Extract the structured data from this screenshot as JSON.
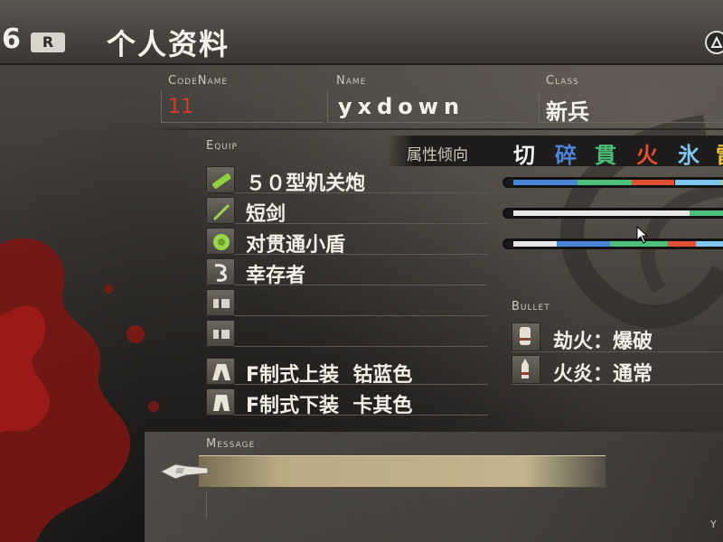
{
  "header": {
    "page_number": "6",
    "r_button": "R",
    "title": "个人资料",
    "triangle_icon": "triangle-button-icon"
  },
  "profile": {
    "codename_label": "CodeName",
    "codename_value": "11",
    "name_label": "Name",
    "name_value": "yxdown",
    "class_label": "Class",
    "class_value": "新兵"
  },
  "equip": {
    "label": "Equip",
    "items": [
      {
        "icon": "machine-gun-icon",
        "label": "５０型机关炮"
      },
      {
        "icon": "sword-icon",
        "label": "短剑"
      },
      {
        "icon": "shield-icon",
        "label": "对贯通小盾"
      },
      {
        "icon": "survivor-skill-icon",
        "label": "幸存者"
      },
      {
        "icon": "empty-slot-icon",
        "label": ""
      },
      {
        "icon": "empty-slot-icon",
        "label": ""
      },
      {
        "icon": "armor-top-icon",
        "label": "F制式上装  钴蓝色"
      },
      {
        "icon": "armor-bottom-icon",
        "label": "F制式下装  卡其色"
      }
    ]
  },
  "attributes": {
    "label": "属性倾向",
    "types": [
      {
        "label": "切",
        "color": "#f2f2f2"
      },
      {
        "label": "碎",
        "color": "#4a86d8"
      },
      {
        "label": "貫",
        "color": "#4cc07a"
      },
      {
        "label": "火",
        "color": "#e0502e"
      },
      {
        "label": "氷",
        "color": "#7ec6ee"
      },
      {
        "label": "雷",
        "color": "#e8c23a"
      }
    ],
    "gauges": [
      [
        {
          "color": "#4a86d8",
          "from": 0.0,
          "to": 0.3
        },
        {
          "color": "#4cc07a",
          "from": 0.3,
          "to": 0.55
        },
        {
          "color": "#e0502e",
          "from": 0.55,
          "to": 0.75
        },
        {
          "color": "#7ec6ee",
          "from": 0.75,
          "to": 0.97
        },
        {
          "color": "#e8c23a",
          "from": 0.97,
          "to": 1.0
        }
      ],
      [
        {
          "color": "#e6e6e6",
          "from": 0.0,
          "to": 0.82
        },
        {
          "color": "#4cc07a",
          "from": 0.82,
          "to": 1.0
        }
      ],
      [
        {
          "color": "#e6e6e6",
          "from": 0.0,
          "to": 0.2
        },
        {
          "color": "#4a86d8",
          "from": 0.2,
          "to": 0.45
        },
        {
          "color": "#4cc07a",
          "from": 0.45,
          "to": 0.72
        },
        {
          "color": "#e0502e",
          "from": 0.72,
          "to": 0.85
        },
        {
          "color": "#7ec6ee",
          "from": 0.85,
          "to": 1.0
        }
      ]
    ]
  },
  "bullet": {
    "label": "Bullet",
    "items": [
      {
        "icon": "bullet-explosive-icon",
        "label": "劫火：爆破"
      },
      {
        "icon": "bullet-normal-icon",
        "label": "火炎：通常"
      }
    ]
  },
  "message": {
    "label": "Message",
    "corner_text": "Y"
  }
}
